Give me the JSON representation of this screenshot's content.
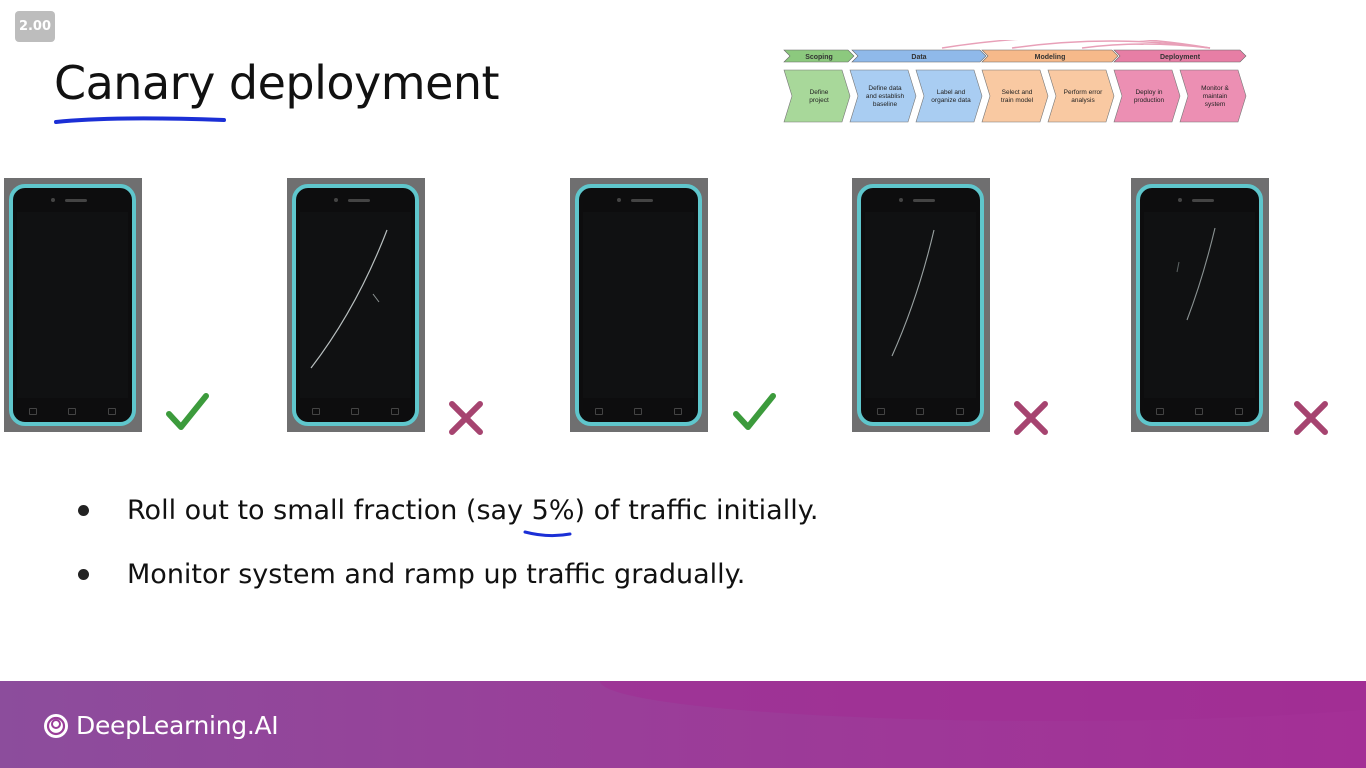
{
  "player": {
    "speed_label": "2.00"
  },
  "slide": {
    "title": "Canary deployment",
    "bullets": [
      "Roll out to small fraction (say 5%) of traffic initially.",
      "Monitor system and ramp up traffic gradually."
    ]
  },
  "lifecycle": {
    "phases": [
      {
        "label": "Scoping",
        "color": "#8cc97e"
      },
      {
        "label": "Data",
        "color": "#8fb9ea"
      },
      {
        "label": "Modeling",
        "color": "#f6b98a"
      },
      {
        "label": "Deployment",
        "color": "#e77ea5"
      }
    ],
    "steps": [
      {
        "label": "Define project",
        "color": "#a8d89a"
      },
      {
        "label": "Define data and establish baseline",
        "color": "#a9cdf2"
      },
      {
        "label": "Label and organize data",
        "color": "#a9cdf2"
      },
      {
        "label": "Select and train model",
        "color": "#f9c9a2"
      },
      {
        "label": "Perform error analysis",
        "color": "#f9c9a2"
      },
      {
        "label": "Deploy in production",
        "color": "#ec8fb3"
      },
      {
        "label": "Monitor & maintain system",
        "color": "#ec8fb3"
      }
    ]
  },
  "phones": [
    {
      "result": "check"
    },
    {
      "result": "cross"
    },
    {
      "result": "check"
    },
    {
      "result": "cross"
    },
    {
      "result": "cross"
    }
  ],
  "colors": {
    "check": "#3c9b3c",
    "cross": "#a64470",
    "footer": "#9a3e99"
  },
  "footer": {
    "brand": "DeepLearning.AI"
  }
}
